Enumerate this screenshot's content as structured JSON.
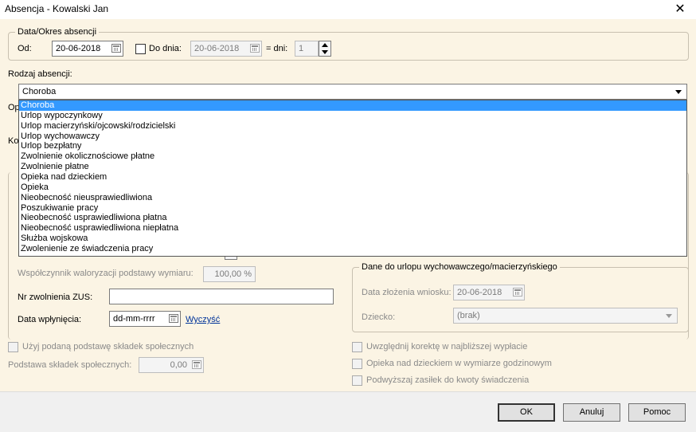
{
  "window": {
    "title": "Absencja - Kowalski Jan",
    "close_symbol": "✕"
  },
  "date_group": {
    "legend": "Data/Okres absencji",
    "od_label": "Od:",
    "od_value": "20-06-2018",
    "do_dnia_label": "Do dnia:",
    "do_dnia_checked": false,
    "do_dnia_value": "20-06-2018",
    "dni_label": "= dni:",
    "dni_value": "1"
  },
  "absence_type": {
    "label": "Rodzaj absencji:",
    "selected": "Choroba",
    "options": [
      "Choroba",
      "Urlop wypoczynkowy",
      "Urlop macierzyński/ojcowski/rodzicielski",
      "Urlop wychowawczy",
      "Urlop bezpłatny",
      "Zwolnienie okolicznościowe płatne",
      "Zwolnienie płatne",
      "Opieka nad dzieckiem",
      "Opieka",
      "Nieobecność nieusprawiedliwiona",
      "Poszukiwanie pracy",
      "Nieobecność usprawiedliwiona płatna",
      "Nieobecność usprawiedliwiona niepłatna",
      "Służba wojskowa",
      "Zwolenienie ze świadczenia pracy"
    ],
    "hidden_label_1": "Op",
    "hidden_label_2": "Ko"
  },
  "left": {
    "wspolczynnik_label": "Współczynnik waloryzacji podstawy wymiaru:",
    "wspolczynnik_value": "100,00 %",
    "nr_zus_label": "Nr zwolnienia ZUS:",
    "nr_zus_value": "",
    "data_wplyniecia_label": "Data wpłynięcia:",
    "data_wplyniecia_value": "dd-mm-rrrr",
    "wyczysc_label": "Wyczyść",
    "uzyj_label": "Użyj podaną podstawę składek społecznych",
    "podstawa_label": "Podstawa składek społecznych:",
    "podstawa_value": "0,00"
  },
  "right_group": {
    "legend": "Dane do urlopu wychowawczego/macierzyńskiego",
    "data_zlozenia_label": "Data złożenia wniosku:",
    "data_zlozenia_value": "20-06-2018",
    "dziecko_label": "Dziecko:",
    "dziecko_value": "(brak)"
  },
  "right_checks": {
    "korekta_label": "Uwzględnij korektę w najbliższej wypłacie",
    "opieka_label": "Opieka nad dzieckiem w wymiarze godzinowym",
    "podwyzszaj_label": "Podwyższaj zasiłek do kwoty świadczenia"
  },
  "buttons": {
    "ok": "OK",
    "anuluj": "Anuluj",
    "pomoc": "Pomoc"
  }
}
